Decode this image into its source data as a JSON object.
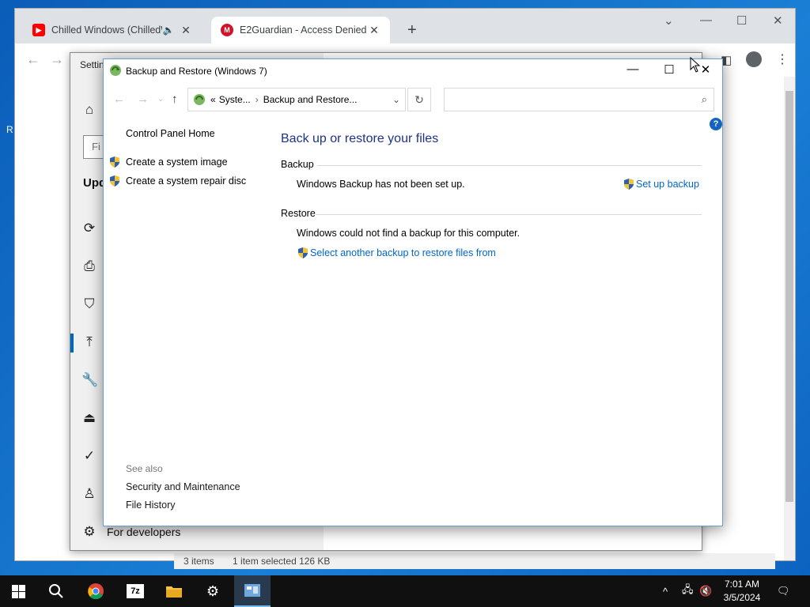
{
  "desktop": {
    "icon_label": "R"
  },
  "browser": {
    "tabs": [
      {
        "title": "Chilled Windows (ChilledWin",
        "favicon": "youtube-icon",
        "active": false
      },
      {
        "title": "E2Guardian - Access Denied",
        "favicon": "e2guardian-icon",
        "active": true
      }
    ]
  },
  "settings": {
    "title": "Settin",
    "search_placeholder": "Fi",
    "section_title": "Upd",
    "last_item": "For developers"
  },
  "explorer_status": {
    "items": "3 items",
    "selected": "1 item selected  126 KB"
  },
  "backup": {
    "window_title": "Backup and Restore (Windows 7)",
    "address": {
      "prefix": "«",
      "crumb1": "Syste...",
      "crumb2": "Backup and Restore..."
    },
    "search_placeholder": "",
    "left": {
      "home": "Control Panel Home",
      "system_image": "Create a system image",
      "repair_disc": "Create a system repair disc",
      "see_also": "See also",
      "security": "Security and Maintenance",
      "file_history": "File History"
    },
    "main": {
      "heading": "Back up or restore your files",
      "backup_header": "Backup",
      "backup_status": "Windows Backup has not been set up.",
      "setup_link": "Set up backup",
      "restore_header": "Restore",
      "restore_status": "Windows could not find a backup for this computer.",
      "select_link": "Select another backup to restore files from"
    }
  },
  "taskbar": {
    "time": "7:01 AM",
    "date": "3/5/2024"
  }
}
